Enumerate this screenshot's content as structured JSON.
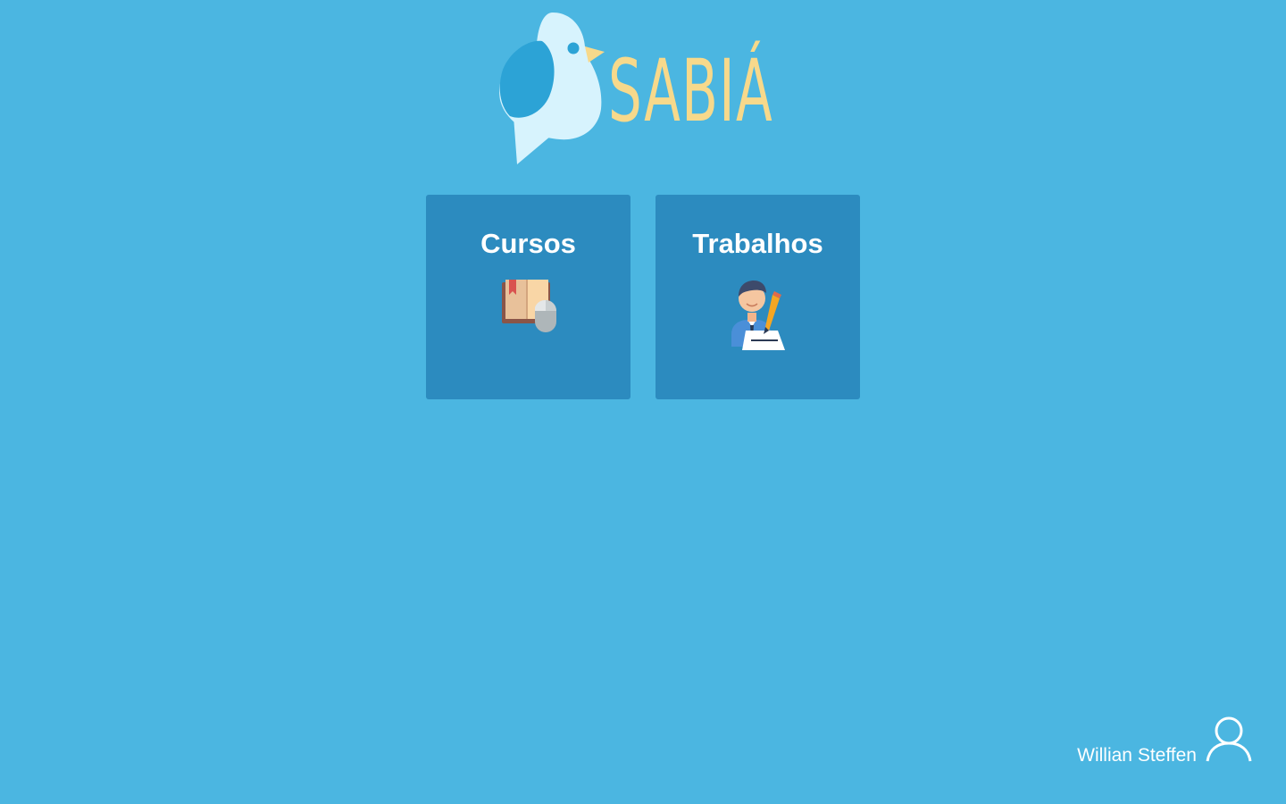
{
  "logo": {
    "text": "SABIÁ",
    "icon": "bird-icon"
  },
  "cards": [
    {
      "title": "Cursos",
      "icon": "book-mouse-icon"
    },
    {
      "title": "Trabalhos",
      "icon": "person-writing-icon"
    }
  ],
  "user": {
    "name": "Willian Steffen",
    "icon": "user-icon"
  },
  "colors": {
    "background": "#4bb6e1",
    "card": "#2c8bbf",
    "logo_text": "#f7d98b"
  }
}
